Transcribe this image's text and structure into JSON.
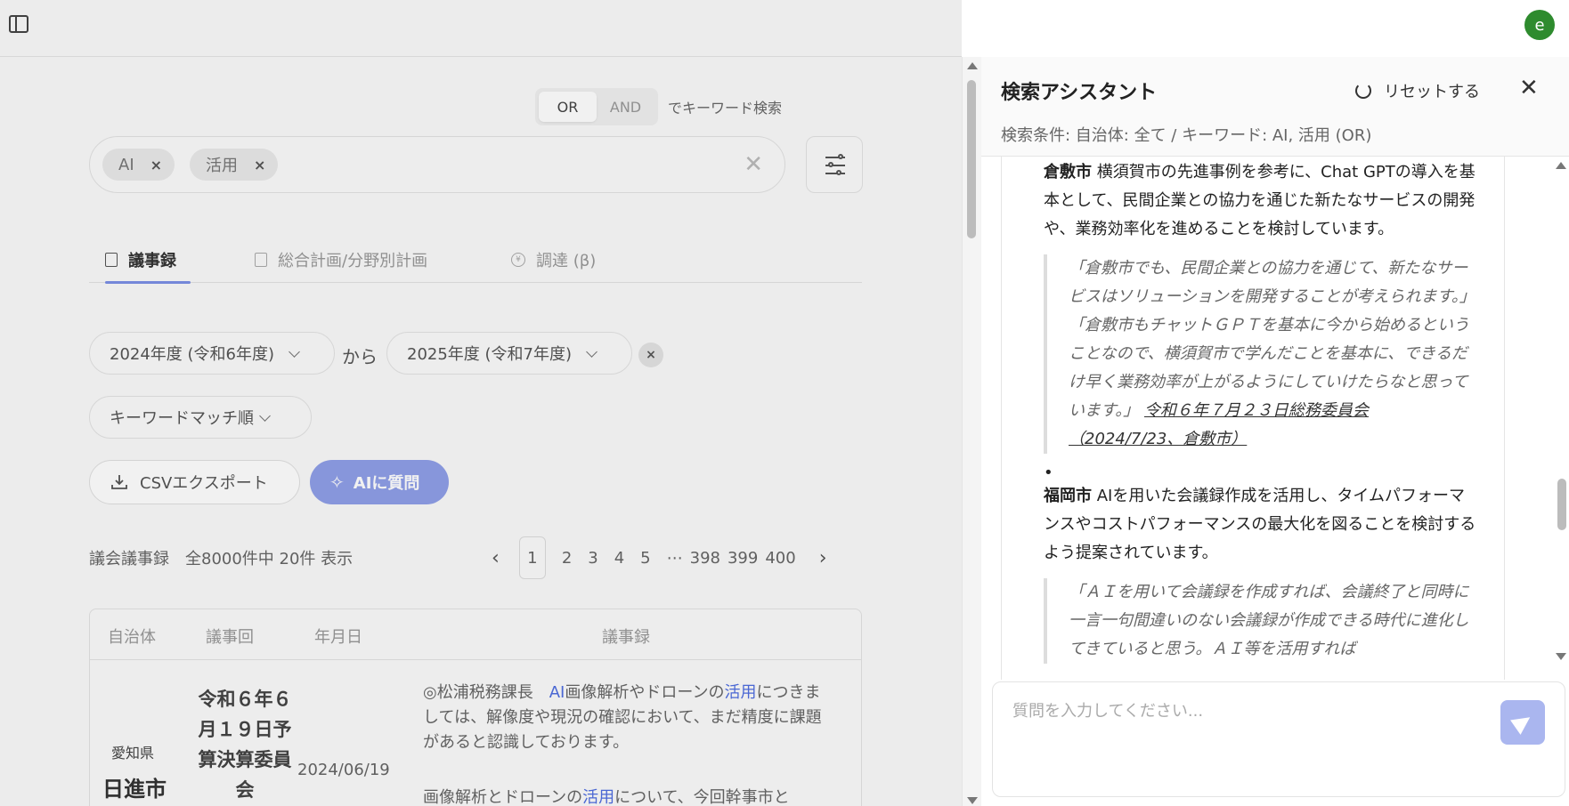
{
  "search": {
    "mode_or": "OR",
    "mode_and": "AND",
    "mode_suffix": "でキーワード検索",
    "chips": [
      "AI",
      "活用"
    ],
    "clear_symbol": "✕"
  },
  "tabs": [
    "議事録",
    "総合計画/分野別計画",
    "調達 (β)"
  ],
  "filters": {
    "year_from": "2024年度 (令和6年度)",
    "connector": "から",
    "year_to": "2025年度 (令和7年度)",
    "sort": "キーワードマッチ順"
  },
  "actions": {
    "csv": "CSVエクスポート",
    "ai": "AIに質問"
  },
  "results": {
    "label": "議会議事録　全8000件中 20件 表示",
    "pages": [
      "1",
      "2",
      "3",
      "4",
      "5",
      "⋯",
      "398",
      "399",
      "400"
    ],
    "prev": "‹",
    "next": "›"
  },
  "table": {
    "headers": [
      "自治体",
      "議事回",
      "年月日",
      "議事録"
    ],
    "row": {
      "prefecture": "愛知県",
      "city": "日進市",
      "session": "令和６年６月１９日予算決算委員会",
      "date": "2024/06/19",
      "text_pre": "◎松浦税務課長　",
      "text_hl1": "AI",
      "text_mid": "画像解析やドローンの",
      "text_hl2": "活用",
      "text_post": "につきましては、解像度や現況の確認において、まだ精度に課題があると認識しております。",
      "text2_pre": "画像解析とドローンの",
      "text2_hl": "活用",
      "text2_post": "について、今回幹事市と"
    }
  },
  "assistant": {
    "title": "検索アシスタント",
    "reset": "リセットする",
    "close": "✕",
    "conditions": "検索条件: 自治体: 全て / キーワード: AI, 活用 (OR)",
    "items": [
      {
        "city": "倉敷市",
        "summary": " 横須賀市の先進事例を参考に、Chat GPTの導入を基本として、民間企業との協力を通じた新たなサービスの開発や、業務効率化を進めることを検討しています。",
        "quote": "「倉敷市でも、民間企業との協力を通じて、新たなサービスはソリューションを開発することが考えられます。」「倉敷市もチャットＧＰＴを基本に今から始めるということなので、横須賀市で学んだことを基本に、できるだけ早く業務効率が上がるようにしていけたらなと思っています。」",
        "source": "令和６年７月２３日総務委員会（2024/7/23、倉敷市）"
      },
      {
        "city": "福岡市",
        "summary": " AIを用いた会議録作成を活用し、タイムパフォーマンスやコストパフォーマンスの最大化を図ることを検討するよう提案されています。",
        "quote": "「ＡＩを用いて会議録を作成すれば、会議終了と同時に一言一句間違いのない会議録が作成できる時代に進化してきていると思う。ＡＩ等を活用すれば",
        "source": ""
      }
    ],
    "input_placeholder": "質問を入力してください..."
  },
  "user": {
    "avatar_letter": "e"
  },
  "colors": {
    "accent": "#7b8fe6",
    "ai_button": "#8f9fe8",
    "avatar": "#2e8b2e",
    "highlight": "#4f6ee0"
  }
}
